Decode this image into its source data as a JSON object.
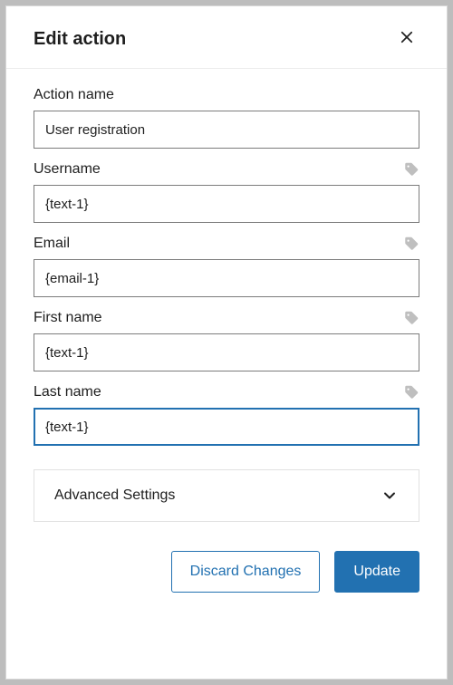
{
  "dialog": {
    "title": "Edit action"
  },
  "fields": {
    "action_name": {
      "label": "Action name",
      "value": "User registration",
      "has_tag": false
    },
    "username": {
      "label": "Username",
      "value": "{text-1}",
      "has_tag": true
    },
    "email": {
      "label": "Email",
      "value": "{email-1}",
      "has_tag": true
    },
    "first_name": {
      "label": "First name",
      "value": "{text-1}",
      "has_tag": true
    },
    "last_name": {
      "label": "Last name",
      "value": "{text-1}",
      "has_tag": true,
      "focused": true
    }
  },
  "advanced": {
    "label": "Advanced Settings"
  },
  "footer": {
    "discard": "Discard Changes",
    "update": "Update"
  },
  "colors": {
    "primary": "#2271b1",
    "border": "#7c7c7c",
    "muted_icon": "#bfbfbf"
  }
}
